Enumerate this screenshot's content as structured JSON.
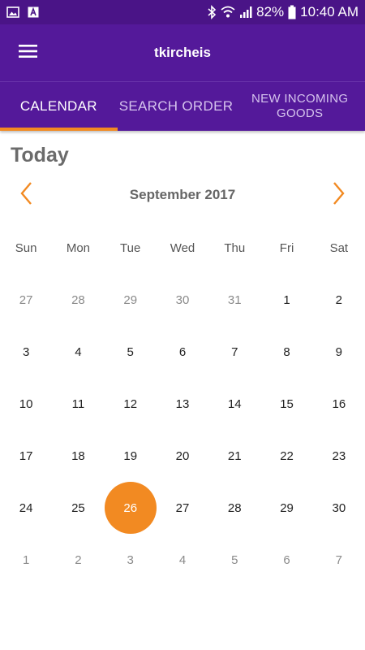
{
  "status_bar": {
    "battery": "82%",
    "time": "10:40 AM",
    "icons": [
      "image-icon",
      "a-icon",
      "bluetooth-icon",
      "wifi-icon",
      "signal-icon",
      "battery-icon"
    ]
  },
  "app_bar": {
    "title": "tkircheis",
    "menu_icon": "hamburger-menu-icon"
  },
  "tabs": [
    {
      "label": "CALENDAR",
      "active": true
    },
    {
      "label": "SEARCH ORDER",
      "active": false
    },
    {
      "label": "NEW INCOMING GOODS",
      "active": false
    }
  ],
  "today_label": "Today",
  "calendar": {
    "month_title": "September 2017",
    "prev_icon": "chevron-left-icon",
    "next_icon": "chevron-right-icon",
    "weekdays": [
      "Sun",
      "Mon",
      "Tue",
      "Wed",
      "Thu",
      "Fri",
      "Sat"
    ],
    "weeks": [
      [
        {
          "d": "27",
          "other": true
        },
        {
          "d": "28",
          "other": true
        },
        {
          "d": "29",
          "other": true
        },
        {
          "d": "30",
          "other": true
        },
        {
          "d": "31",
          "other": true
        },
        {
          "d": "1"
        },
        {
          "d": "2"
        }
      ],
      [
        {
          "d": "3"
        },
        {
          "d": "4"
        },
        {
          "d": "5"
        },
        {
          "d": "6"
        },
        {
          "d": "7"
        },
        {
          "d": "8"
        },
        {
          "d": "9"
        }
      ],
      [
        {
          "d": "10"
        },
        {
          "d": "11"
        },
        {
          "d": "12"
        },
        {
          "d": "13"
        },
        {
          "d": "14"
        },
        {
          "d": "15"
        },
        {
          "d": "16"
        }
      ],
      [
        {
          "d": "17"
        },
        {
          "d": "18"
        },
        {
          "d": "19"
        },
        {
          "d": "20"
        },
        {
          "d": "21"
        },
        {
          "d": "22"
        },
        {
          "d": "23"
        }
      ],
      [
        {
          "d": "24"
        },
        {
          "d": "25"
        },
        {
          "d": "26",
          "selected": true
        },
        {
          "d": "27"
        },
        {
          "d": "28"
        },
        {
          "d": "29"
        },
        {
          "d": "30"
        }
      ],
      [
        {
          "d": "1",
          "other": true
        },
        {
          "d": "2",
          "other": true
        },
        {
          "d": "3",
          "other": true
        },
        {
          "d": "4",
          "other": true
        },
        {
          "d": "5",
          "other": true
        },
        {
          "d": "6",
          "other": true
        },
        {
          "d": "7",
          "other": true
        }
      ]
    ]
  },
  "colors": {
    "primary": "#54199a",
    "status_bar": "#4a1487",
    "accent": "#f28a22"
  }
}
